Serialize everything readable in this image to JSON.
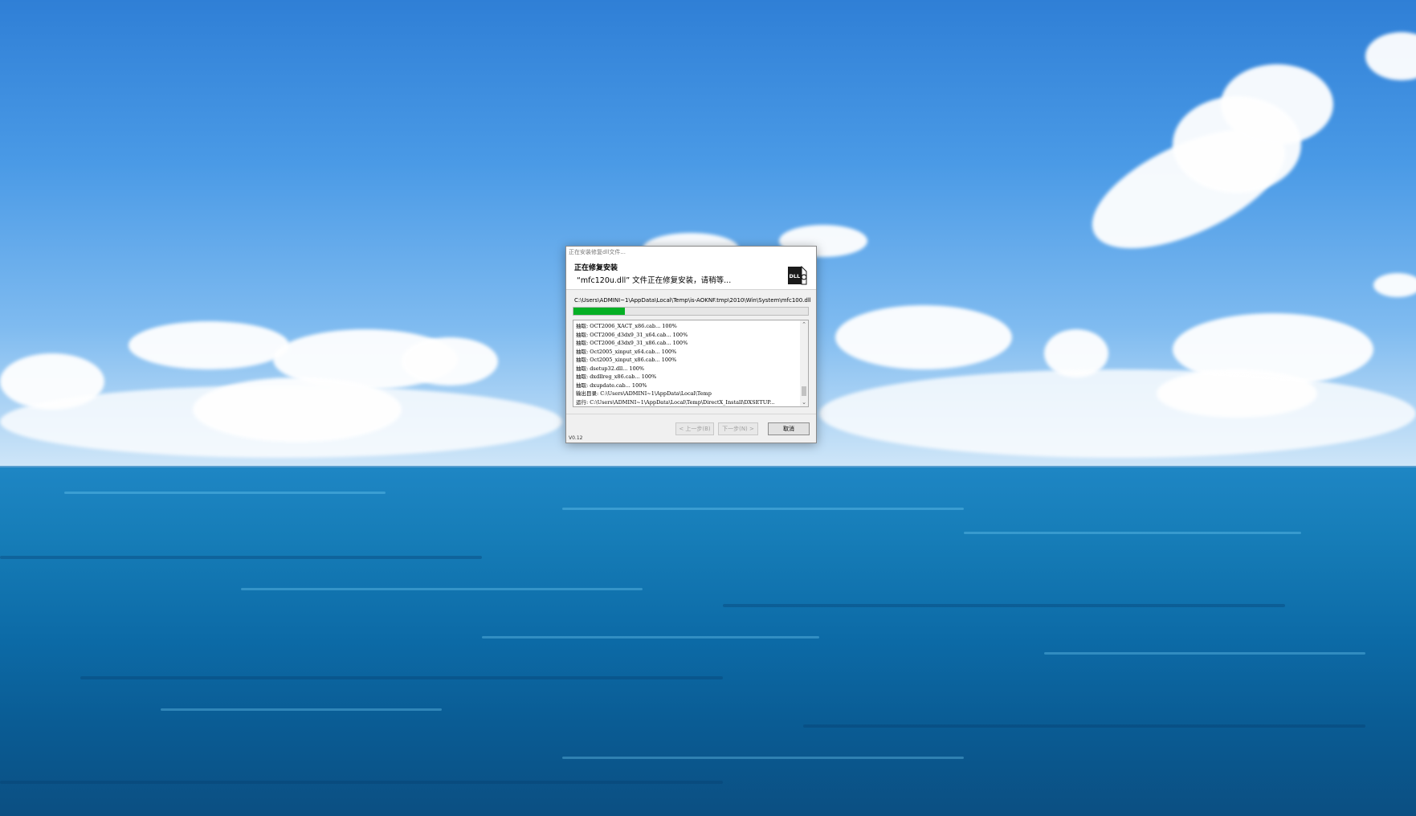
{
  "window": {
    "title": "正在安装修复dll文件...",
    "header_title": "正在修复安装",
    "header_subtitle": "“mfc120u.dll” 文件正在修复安装，请稍等...",
    "icon_label": "DLL",
    "current_path": "C:\\Users\\ADMINI~1\\AppData\\Local\\Temp\\is-AOKNF.tmp\\2010\\Win\\System\\mfc100.dll",
    "progress_fraction": 0.22,
    "progress_color": "#06b025",
    "log": [
      "抽取: OCT2006_XACT_x86.cab... 100%",
      "抽取: OCT2006_d3dx9_31_x64.cab... 100%",
      "抽取: OCT2006_d3dx9_31_x86.cab... 100%",
      "抽取: Oct2005_xinput_x64.cab... 100%",
      "抽取: Oct2005_xinput_x86.cab... 100%",
      "抽取: dsetup32.dll... 100%",
      "抽取: dxdllreg_x86.cab... 100%",
      "抽取: dxupdate.cab... 100%",
      "输出目录: C:\\Users\\ADMINI~1\\AppData\\Local\\Temp",
      "运行: C:\\Users\\ADMINI~1\\AppData\\Local\\Temp\\DirectX_Install\\DXSETUP..."
    ],
    "buttons": {
      "back": "< 上一步(B)",
      "next": "下一步(N) >",
      "cancel": "取消"
    },
    "version": "V0.12"
  }
}
